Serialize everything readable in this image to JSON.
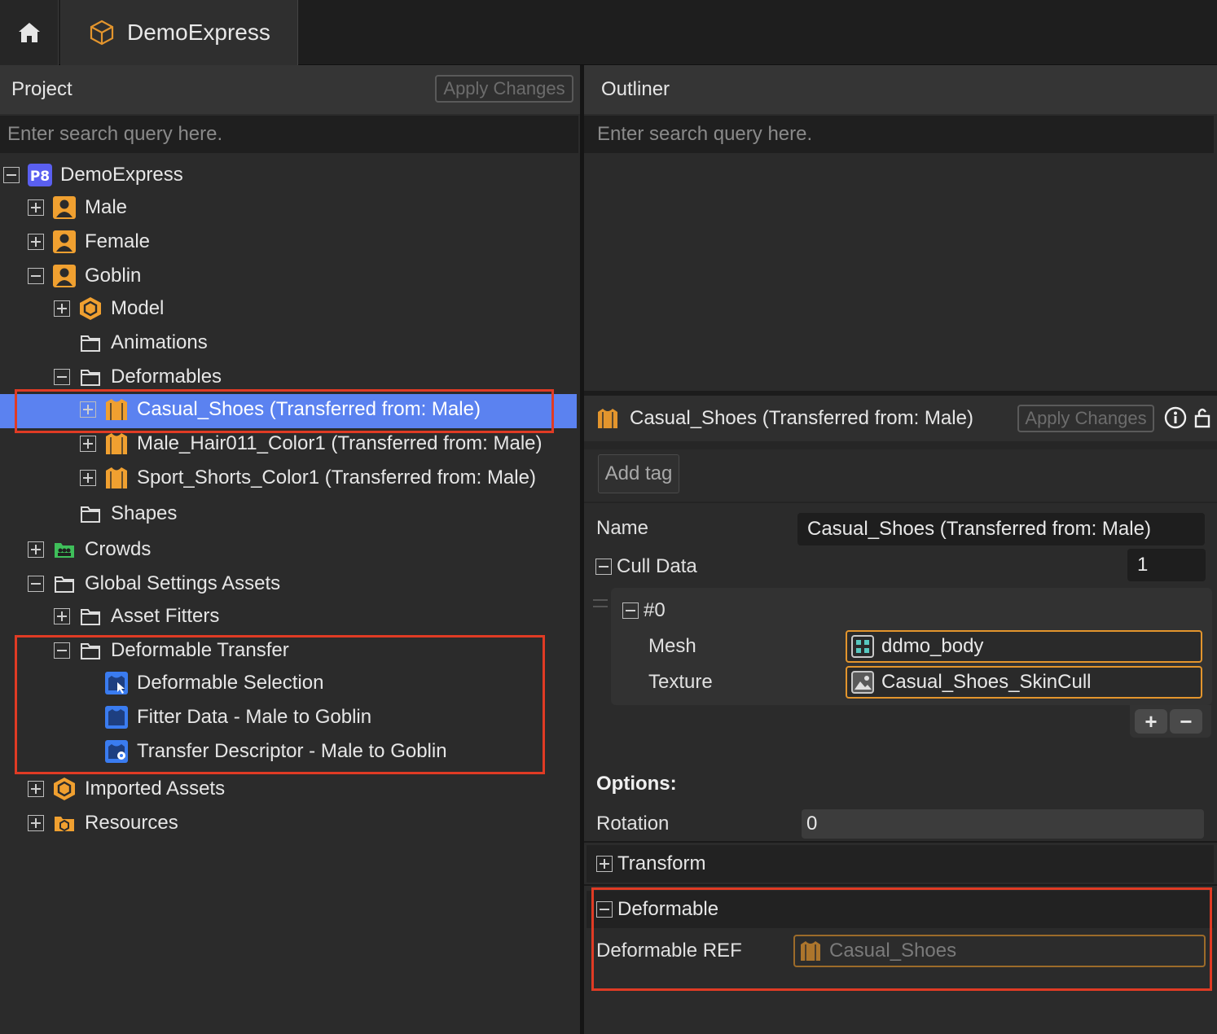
{
  "topbar": {
    "tab_label": "DemoExpress"
  },
  "project": {
    "title": "Project",
    "apply_label": "Apply Changes",
    "search_placeholder": "Enter search query here.",
    "tree": [
      {
        "label": "DemoExpress",
        "icon": "p8-project-icon",
        "badge": "P8",
        "expander": "minus"
      },
      {
        "label": "Male",
        "icon": "character-icon",
        "expander": "plus"
      },
      {
        "label": "Female",
        "icon": "character-icon",
        "expander": "plus"
      },
      {
        "label": "Goblin",
        "icon": "character-icon",
        "expander": "minus"
      },
      {
        "label": "Model",
        "icon": "model-hexagon-icon",
        "expander": "plus"
      },
      {
        "label": "Animations",
        "icon": "folder-icon",
        "expander": "none"
      },
      {
        "label": "Deformables",
        "icon": "folder-icon",
        "expander": "minus"
      },
      {
        "label": "Casual_Shoes (Transferred from: Male)",
        "icon": "shirt-icon",
        "expander": "plus",
        "selected": true
      },
      {
        "label": "Male_Hair011_Color1 (Transferred from: Male)",
        "icon": "shirt-icon",
        "expander": "plus"
      },
      {
        "label": "Sport_Shorts_Color1 (Transferred from: Male)",
        "icon": "shirt-icon",
        "expander": "plus"
      },
      {
        "label": "Shapes",
        "icon": "folder-icon",
        "expander": "none"
      },
      {
        "label": "Crowds",
        "icon": "crowds-folder-icon",
        "expander": "plus"
      },
      {
        "label": "Global Settings Assets",
        "icon": "folder-icon",
        "expander": "minus"
      },
      {
        "label": "Asset Fitters",
        "icon": "folder-icon",
        "expander": "plus"
      },
      {
        "label": "Deformable Transfer",
        "icon": "folder-icon",
        "expander": "minus"
      },
      {
        "label": "Deformable Selection",
        "icon": "deformable-selection-icon",
        "expander": "none"
      },
      {
        "label": "Fitter Data - Male to Goblin",
        "icon": "fitter-data-icon",
        "expander": "none"
      },
      {
        "label": "Transfer Descriptor - Male to Goblin",
        "icon": "transfer-descriptor-icon",
        "expander": "none"
      },
      {
        "label": "Imported Assets",
        "icon": "model-hexagon-icon",
        "expander": "plus"
      },
      {
        "label": "Resources",
        "icon": "resources-folder-icon",
        "expander": "plus"
      }
    ]
  },
  "outliner": {
    "title": "Outliner",
    "search_placeholder": "Enter search query here."
  },
  "inspector": {
    "title": "Casual_Shoes (Transferred from: Male)",
    "apply_label": "Apply Changes",
    "add_tag_label": "Add tag",
    "name_label": "Name",
    "name_value": "Casual_Shoes (Transferred from: Male)",
    "cull_data_label": "Cull Data",
    "cull_data_count": "1",
    "cull_item_label": "#0",
    "mesh_label": "Mesh",
    "mesh_value": "ddmo_body",
    "texture_label": "Texture",
    "texture_value": "Casual_Shoes_SkinCull",
    "add_label": "+",
    "remove_label": "−",
    "options_label": "Options:",
    "rotation_label": "Rotation",
    "rotation_value": "0",
    "transform_label": "Transform",
    "deformable_label": "Deformable",
    "deformable_ref_label": "Deformable REF",
    "deformable_ref_value": "Casual_Shoes"
  },
  "colors": {
    "selection": "#5b82f0",
    "accent_orange": "#e3952d",
    "highlight_red": "#e03b24",
    "asset_blue": "#3a7cf0"
  }
}
